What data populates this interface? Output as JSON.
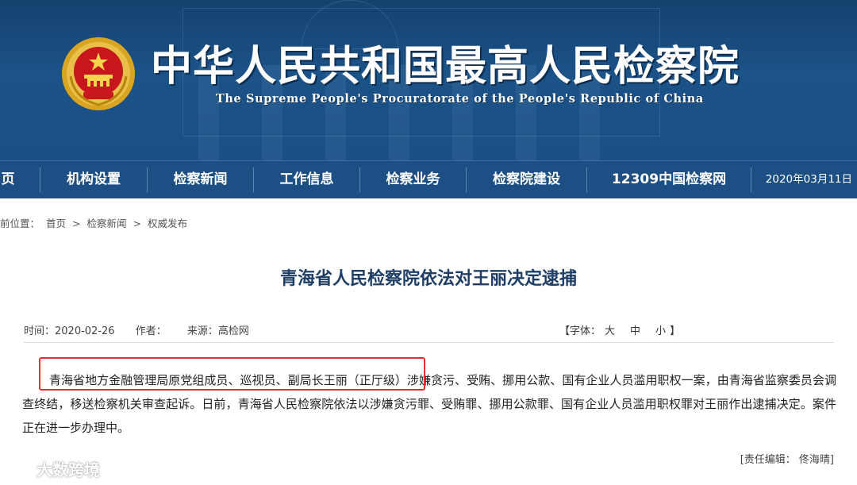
{
  "header": {
    "site_title": "中华人民共和国最高人民检察院",
    "site_subtitle": "The Supreme People's Procuratorate of the People's Republic of China",
    "emblem_icon": "national-emblem-icon"
  },
  "nav": {
    "items": [
      "页",
      "机构设置",
      "检察新闻",
      "工作信息",
      "检察业务",
      "检察院建设",
      "12309中国检察网"
    ],
    "date": "2020年03月11日"
  },
  "breadcrumb": {
    "prefix": "前位置：",
    "items": [
      "首页",
      "检察新闻",
      "权威发布"
    ],
    "separator": ">"
  },
  "article": {
    "title": "青海省人民检察院依法对王丽决定逮捕",
    "time": "时间：2020-02-26",
    "author": "作者：",
    "source": "来源：高检网",
    "font_size_label": "【字体：",
    "font_sizes": [
      "大",
      "中",
      "小"
    ],
    "font_size_end": "】",
    "body": "青海省地方金融管理局原党组成员、巡视员、副局长王丽（正厅级）涉嫌贪污、受贿、挪用公款、国有企业人员滥用职权一案，由青海省监察委员会调查终结，移送检察机关审查起诉。日前，青海省人民检察院依法以涉嫌贪污罪、受贿罪、挪用公款罪、国有企业人员滥用职权罪对王丽作出逮捕决定。案件正在进一步办理中。",
    "editor": "[责任编辑：  佟海晴]"
  },
  "watermark": {
    "text": "大数跨境",
    "icon": "weibo-logo-icon"
  },
  "colors": {
    "header_blue": "#1b5287",
    "nav_blue": "#1d4f84",
    "title_blue": "#1f3e66",
    "highlight_red": "#e03030"
  }
}
